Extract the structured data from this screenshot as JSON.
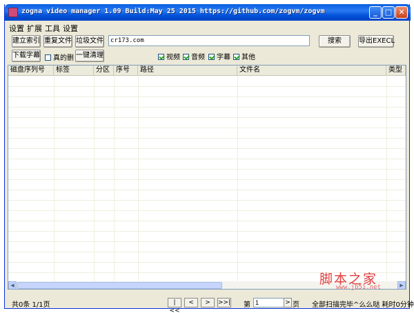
{
  "window": {
    "title": "zogna video manager 1.09 Build:May 25 2015  https://github.com/zogvm/zogvm",
    "controls": {
      "minimize": "_",
      "maximize": "□",
      "close": "✕"
    }
  },
  "menu": [
    "设置",
    "扩展",
    "工具",
    "设置"
  ],
  "toolbar": {
    "build_index": "建立索引",
    "duplicate_files": "重复文件",
    "junk_files": "垃圾文件",
    "search_value": "cr173.com",
    "search_button": "搜索",
    "export_button": "导出EXECL",
    "download_subtitles": "下载字幕",
    "really_delete_label": "真的删",
    "really_delete_checked": false,
    "one_click_clean": "一键清理",
    "filters": [
      {
        "label": "视频",
        "checked": true
      },
      {
        "label": "音频",
        "checked": true
      },
      {
        "label": "字幕",
        "checked": true
      },
      {
        "label": "其他",
        "checked": true
      }
    ]
  },
  "table": {
    "columns": [
      "磁盘序列号",
      "标签",
      "分区",
      "序号",
      "路径",
      "文件名",
      "类型"
    ],
    "rows": []
  },
  "status": {
    "summary": "共0条 1/1页",
    "first": "|<<",
    "prev": "<",
    "next": ">",
    "last": ">>|",
    "page_label": "第",
    "page_value": "1",
    "page_suffix": "页",
    "scan_status": "全部扫描完毕^么么哒 耗时0分钟"
  },
  "watermark": {
    "text": "脚本之家",
    "url": "www.jb51.net"
  }
}
